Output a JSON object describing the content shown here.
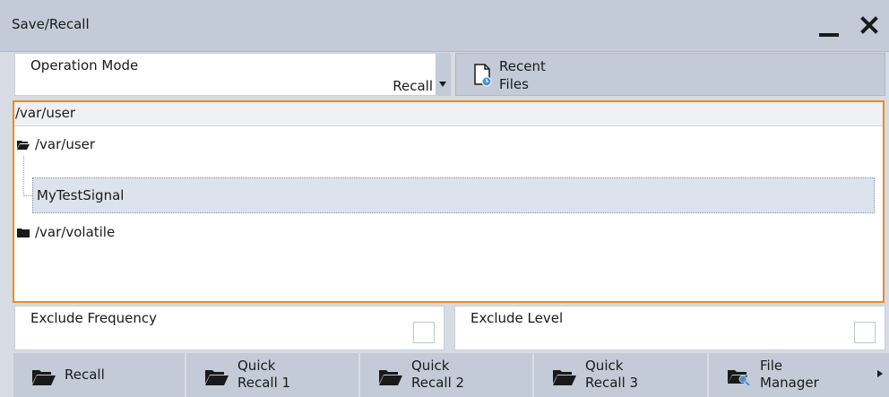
{
  "window": {
    "title": "Save/Recall"
  },
  "operation_mode": {
    "label": "Operation Mode",
    "value": "Recall"
  },
  "recent_files": {
    "label_line1": "Recent",
    "label_line2": "Files"
  },
  "browser": {
    "path": "/var/user",
    "tree": [
      {
        "label": "/var/user",
        "icon": "folder-open-icon"
      },
      {
        "label": "MyTestSignal",
        "icon": ""
      },
      {
        "label": "/var/volatile",
        "icon": "folder-closed-icon"
      }
    ]
  },
  "exclude_frequency": {
    "label": "Exclude Frequency",
    "checked": false
  },
  "exclude_level": {
    "label": "Exclude Level",
    "checked": false
  },
  "bottom": {
    "recall": {
      "label": "Recall"
    },
    "quick1": {
      "line1": "Quick",
      "line2": "Recall 1"
    },
    "quick2": {
      "line1": "Quick",
      "line2": "Recall 2"
    },
    "quick3": {
      "line1": "Quick",
      "line2": "Recall 3"
    },
    "file_manager": {
      "line1": "File",
      "line2": "Manager"
    }
  },
  "colors": {
    "focus": "#f08a1c",
    "bar": "#c3cbd8",
    "selected_row": "#dde3ec"
  }
}
